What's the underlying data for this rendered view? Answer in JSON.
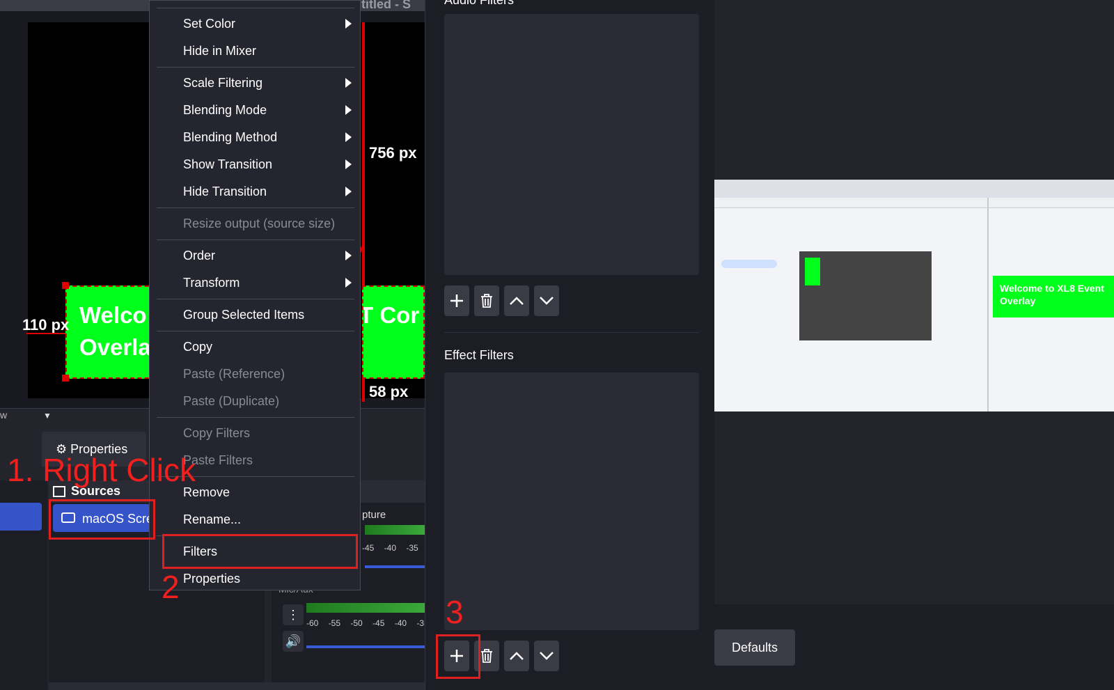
{
  "window": {
    "title": "ntitled - S"
  },
  "preview": {
    "text_left": [
      "Welco",
      "Overla"
    ],
    "text_right": "T Cor",
    "measure_left": "110 px",
    "measure_top": "756 px",
    "measure_bottom": "58 px",
    "scale_text": "w"
  },
  "docks": {
    "properties_label": "Properties",
    "sources_title": "Sources",
    "source_item": "macOS Scre",
    "capture_label": "pture",
    "meter_ticks": [
      "-45",
      "-40",
      "-35",
      "-"
    ],
    "meter_ticks_full": [
      "-60",
      "-55",
      "-50",
      "-45",
      "-40",
      "-35",
      "-"
    ],
    "micaux_label": "Mic/Aux"
  },
  "context_menu": {
    "items": [
      {
        "label": "Set Color",
        "submenu": true,
        "disabled": false
      },
      {
        "label": "Hide in Mixer",
        "submenu": false,
        "disabled": false
      },
      {
        "label": "Scale Filtering",
        "submenu": true,
        "disabled": false
      },
      {
        "label": "Blending Mode",
        "submenu": true,
        "disabled": false
      },
      {
        "label": "Blending Method",
        "submenu": true,
        "disabled": false
      },
      {
        "label": "Show Transition",
        "submenu": true,
        "disabled": false
      },
      {
        "label": "Hide Transition",
        "submenu": true,
        "disabled": false
      },
      {
        "label": "Resize output (source size)",
        "submenu": false,
        "disabled": true
      },
      {
        "label": "Order",
        "submenu": true,
        "disabled": false
      },
      {
        "label": "Transform",
        "submenu": true,
        "disabled": false
      },
      {
        "label": "Group Selected Items",
        "submenu": false,
        "disabled": false
      },
      {
        "label": "Copy",
        "submenu": false,
        "disabled": false
      },
      {
        "label": "Paste (Reference)",
        "submenu": false,
        "disabled": true
      },
      {
        "label": "Paste (Duplicate)",
        "submenu": false,
        "disabled": true
      },
      {
        "label": "Copy Filters",
        "submenu": false,
        "disabled": true
      },
      {
        "label": "Paste Filters",
        "submenu": false,
        "disabled": true
      },
      {
        "label": "Remove",
        "submenu": false,
        "disabled": false
      },
      {
        "label": "Rename...",
        "submenu": false,
        "disabled": false
      },
      {
        "label": "Filters",
        "submenu": false,
        "disabled": false
      },
      {
        "label": "Properties",
        "submenu": false,
        "disabled": false
      }
    ]
  },
  "filters_dialog": {
    "audio_title": "Audio Filters",
    "effect_title": "Effect Filters",
    "defaults_label": "Defaults",
    "preview_text": [
      "Welcome to XL8 Event",
      "Overlay"
    ]
  },
  "annotations": {
    "step1": "1. Right Click",
    "step2": "2",
    "step3": "3",
    "color": "#f21f1f"
  },
  "colors": {
    "accent": "#3554c9",
    "green": "#00ff1a",
    "annotation": "#e02020"
  }
}
